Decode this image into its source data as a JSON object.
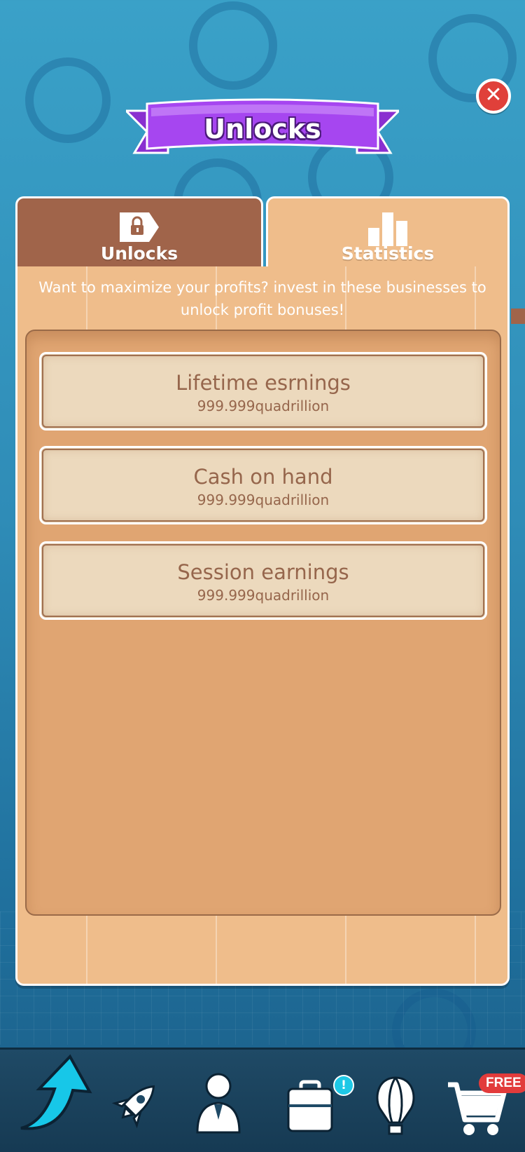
{
  "header": {
    "title": "Unlocks",
    "close_label": "✕"
  },
  "tabs": [
    {
      "label": "Unlocks",
      "icon": "lock-tag-icon",
      "active": true
    },
    {
      "label": "Statistics",
      "icon": "bar-chart-icon",
      "active": false
    }
  ],
  "info_text": "Want to maximize your profits? invest in these businesses to unlock profit bonuses!",
  "stats": [
    {
      "label": "Lifetime esrnings",
      "value": "999.999quadrillion"
    },
    {
      "label": "Cash on hand",
      "value": "999.999quadrillion"
    },
    {
      "label": "Session earnings",
      "value": "999.999quadrillion"
    }
  ],
  "nav": {
    "items": [
      "upgrade-arrow-icon",
      "rocket-icon",
      "manager-icon",
      "briefcase-icon",
      "balloon-icon",
      "cart-icon"
    ],
    "briefcase_badge": "!",
    "shop_badge": "FREE"
  },
  "colors": {
    "background": "#2f8cb7",
    "panel": "#efbd8b",
    "active_tab": "#a0644a",
    "ribbon": "#a646f0",
    "card_text": "#96664c",
    "accent_cyan": "#1ec8e6",
    "badge_red": "#e23b3b"
  }
}
